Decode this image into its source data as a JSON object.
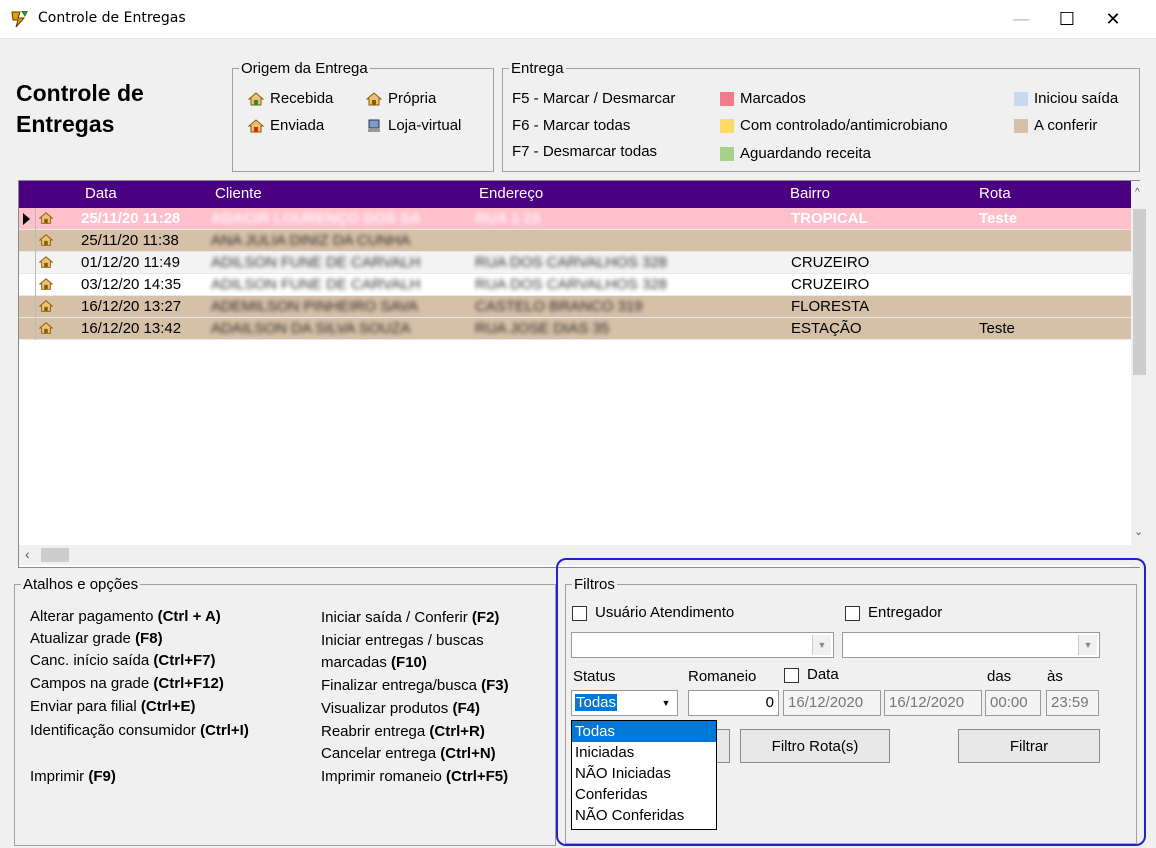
{
  "window": {
    "title": "Controle de Entregas"
  },
  "header": {
    "title_line1": "Controle de",
    "title_line2": "Entregas"
  },
  "origem": {
    "legend": "Origem da Entrega",
    "items": [
      "Recebida",
      "Própria",
      "Enviada",
      "Loja-virtual"
    ]
  },
  "entrega": {
    "legend": "Entrega",
    "keys": [
      "F5 - Marcar / Desmarcar",
      "F6 - Marcar todas",
      "F7 - Desmarcar todas"
    ],
    "legend_items": [
      {
        "label": "Marcados",
        "color": "#f27a8a"
      },
      {
        "label": "Com controlado/antimicrobiano",
        "color": "#ffd966"
      },
      {
        "label": "Aguardando receita",
        "color": "#a8d08d"
      },
      {
        "label": "Iniciou saída",
        "color": "#c6d9f1"
      },
      {
        "label": "A conferir",
        "color": "#d5c0a8"
      }
    ]
  },
  "grid": {
    "columns": [
      "Data",
      "Cliente",
      "Endereço",
      "Bairro",
      "Rota"
    ],
    "rows": [
      {
        "data": "25/11/20 11:28",
        "cliente": "ADACIR LOURENÇO DOS SA",
        "endereco": "RUA 1 23",
        "bairro": "TROPICAL",
        "rota": "Teste"
      },
      {
        "data": "25/11/20 11:38",
        "cliente": "ANA JULIA DINIZ DA CUNHA",
        "endereco": "",
        "bairro": "",
        "rota": ""
      },
      {
        "data": "01/12/20 11:49",
        "cliente": "ADILSON FUNE DE CARVALH",
        "endereco": "RUA DOS CARVALHOS 328",
        "bairro": "CRUZEIRO",
        "rota": ""
      },
      {
        "data": "03/12/20 14:35",
        "cliente": "ADILSON FUNE DE CARVALH",
        "endereco": "RUA DOS CARVALHOS 328",
        "bairro": "CRUZEIRO",
        "rota": ""
      },
      {
        "data": "16/12/20 13:27",
        "cliente": "ADEMILSON PINHEIRO SAVA",
        "endereco": "CASTELO BRANCO 319",
        "bairro": "FLORESTA",
        "rota": ""
      },
      {
        "data": "16/12/20 13:42",
        "cliente": "ADAILSON DA SILVA SOUZA",
        "endereco": "RUA JOSE DIAS 35",
        "bairro": "ESTAÇÃO",
        "rota": "Teste"
      }
    ],
    "colors": {
      "header": "#4b0082",
      "marcado": "#ffc0cb",
      "conferir": "#d5c0a8"
    }
  },
  "atalhos": {
    "legend": "Atalhos e opções",
    "left": [
      {
        "text": "Alterar pagamento ",
        "key": "(Ctrl + A)"
      },
      {
        "text": "Atualizar grade ",
        "key": "(F8)"
      },
      {
        "text": "Canc. início saída ",
        "key": "(Ctrl+F7)"
      },
      {
        "text": "Campos na grade ",
        "key": "(Ctrl+F12)"
      },
      {
        "text": "Enviar para filial ",
        "key": "(Ctrl+E)"
      },
      {
        "text": "Identificação consumidor ",
        "key": "(Ctrl+I)"
      },
      {
        "text": "Imprimir ",
        "key": "(F9)"
      }
    ],
    "right": [
      {
        "text": "Iniciar saída / Conferir ",
        "key": "(F2)"
      },
      {
        "text": "Iniciar entregas / buscas",
        "key": ""
      },
      {
        "text": "marcadas ",
        "key": "(F10)"
      },
      {
        "text": "Finalizar entrega/busca ",
        "key": "(F3)"
      },
      {
        "text": "Visualizar produtos ",
        "key": "(F4)"
      },
      {
        "text": "Reabrir entrega ",
        "key": "(Ctrl+R)"
      },
      {
        "text": "Cancelar entrega ",
        "key": "(Ctrl+N)"
      },
      {
        "text": "Imprimir romaneio ",
        "key": "(Ctrl+F5)"
      }
    ]
  },
  "filtros": {
    "legend": "Filtros",
    "usuario_label": "Usuário Atendimento",
    "entregador_label": "Entregador",
    "status_label": "Status",
    "romaneio_label": "Romaneio",
    "data_label": "Data",
    "das_label": "das",
    "as_label": "às",
    "status_value": "Todas",
    "romaneio_value": "0",
    "data_inicio": "16/12/2020",
    "data_fim": "16/12/2020",
    "hora_inicio": "00:00",
    "hora_fim": "23:59",
    "filtro_rota_label": "Filtro Rota(s)",
    "filtrar_label": "Filtrar",
    "status_options": [
      "Todas",
      "Iniciadas",
      "NÃO Iniciadas",
      "Conferidas",
      "NÃO Conferidas"
    ]
  }
}
